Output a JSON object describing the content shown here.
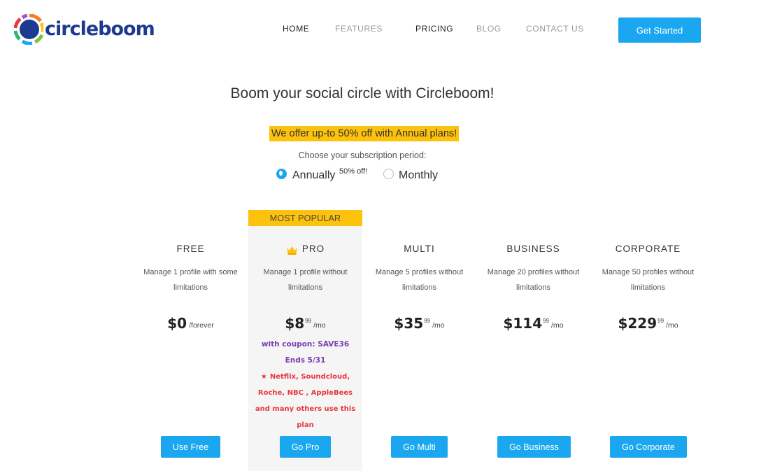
{
  "brand": {
    "name": "circleboom"
  },
  "nav": {
    "items": [
      {
        "label": "HOME",
        "state": "active"
      },
      {
        "label": "FEATURES",
        "state": "muted"
      },
      {
        "label": "PRICING",
        "state": "active"
      },
      {
        "label": "BLOG",
        "state": "muted"
      },
      {
        "label": "CONTACT US",
        "state": "muted"
      }
    ],
    "cta_label": "Get Started"
  },
  "hero": {
    "title": "Boom your social circle with Circleboom!",
    "promo": "We offer up-to 50% off with Annual plans!",
    "period_label": "Choose your subscription period:",
    "options": [
      {
        "label": "Annually",
        "note": "50% off!",
        "selected": true
      },
      {
        "label": "Monthly",
        "selected": false
      }
    ]
  },
  "plans": {
    "most_popular_label": "MOST POPULAR",
    "items": [
      {
        "name": "FREE",
        "desc": "Manage 1 profile with some limitations",
        "price": "$0",
        "cents": "",
        "per": "/forever",
        "button": "Use Free"
      },
      {
        "name": "PRO",
        "desc": "Manage 1 profile without limitations",
        "price": "$8",
        "cents": "99",
        "per": "/mo",
        "coupon": "with coupon: SAVE36",
        "ends": "Ends 5/31",
        "users_note": "Netflix, Soundcloud, Roche, NBC , AppleBees and many others use this plan",
        "button": "Go Pro"
      },
      {
        "name": "MULTI",
        "desc": "Manage 5 profiles without limitations",
        "price": "$35",
        "cents": "99",
        "per": "/mo",
        "button": "Go Multi"
      },
      {
        "name": "BUSINESS",
        "desc": "Manage 20 profiles without limitations",
        "price": "$114",
        "cents": "99",
        "per": "/mo",
        "button": "Go Business"
      },
      {
        "name": "CORPORATE",
        "desc": "Manage 50 profiles without limitations",
        "price": "$229",
        "cents": "99",
        "per": "/mo",
        "button": "Go Corporate"
      }
    ]
  },
  "colors": {
    "accent": "#1aa7f0",
    "highlight": "#fdc20c",
    "coupon": "#7a3fb0",
    "note": "#e8383d",
    "brand_text": "#1c3a8f"
  },
  "icons": [
    "circleboom-logo-icon",
    "crown-icon",
    "star-icon"
  ]
}
